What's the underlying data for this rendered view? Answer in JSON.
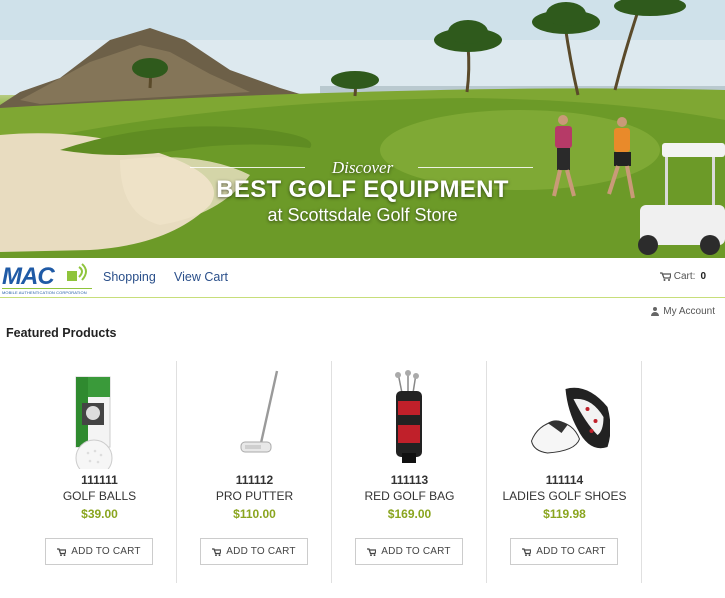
{
  "hero": {
    "discover": "Discover",
    "headline": "BEST GOLF EQUIPMENT",
    "subline": "at Scottsdale Golf Store"
  },
  "brand": {
    "logo_text": "MAC",
    "logo_tagline": "MOBILE AUTHENTICATION CORPORATION",
    "accent_color": "#8fc43c",
    "brand_color": "#1f5aa6"
  },
  "nav": {
    "shopping": "Shopping",
    "view_cart": "View Cart",
    "cart_label": "Cart:",
    "cart_count": "0"
  },
  "account": {
    "label": "My Account"
  },
  "featured": {
    "title": "Featured Products",
    "button_label": "ADD TO CART",
    "price_color": "#8aa51f",
    "products": [
      {
        "sku": "111111",
        "name": "GOLF BALLS",
        "price": "$39.00",
        "icon": "golf-balls-image"
      },
      {
        "sku": "111112",
        "name": "PRO PUTTER",
        "price": "$110.00",
        "icon": "putter-image"
      },
      {
        "sku": "111113",
        "name": "RED GOLF BAG",
        "price": "$169.00",
        "icon": "golf-bag-image"
      },
      {
        "sku": "111114",
        "name": "LADIES GOLF SHOES",
        "price": "$119.98",
        "icon": "golf-shoes-image"
      }
    ]
  }
}
